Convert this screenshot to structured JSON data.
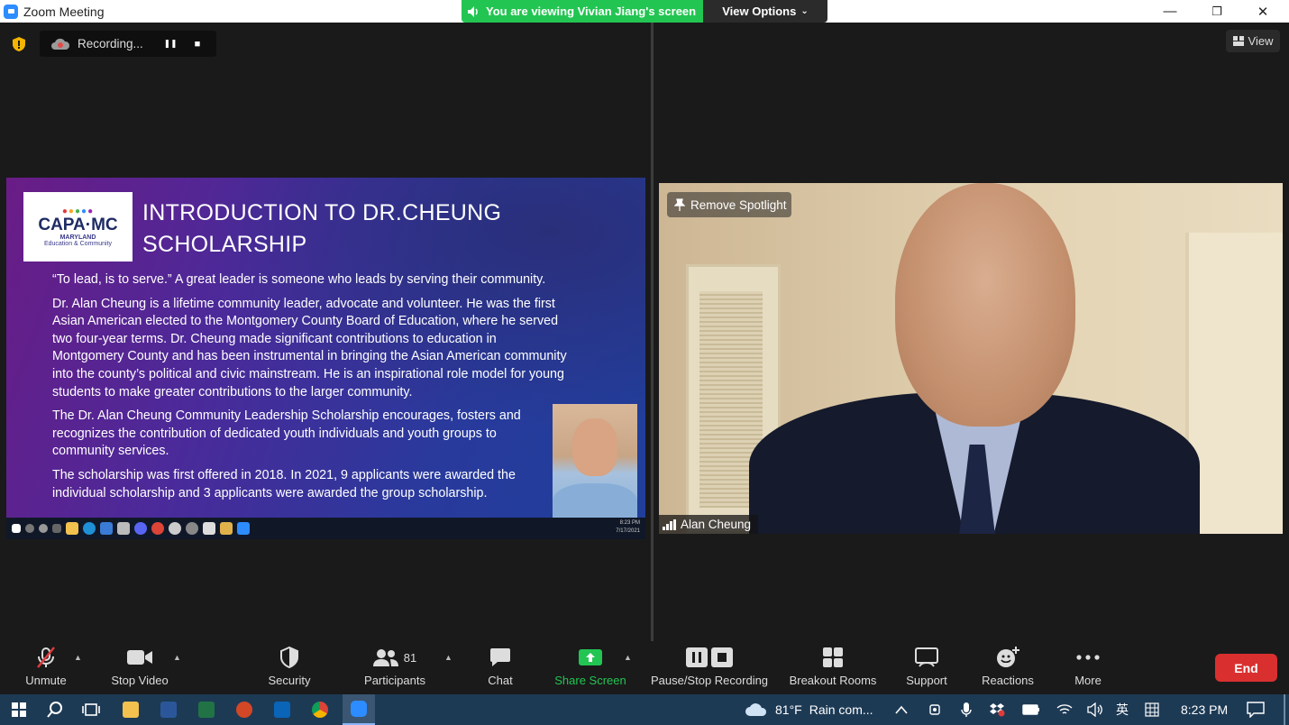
{
  "window": {
    "title": "Zoom Meeting",
    "minimize": "—",
    "restore": "❐",
    "close": "✕"
  },
  "share_banner": {
    "viewing": "You are viewing Vivian Jiang's screen",
    "view_options": "View Options"
  },
  "recording": {
    "label": "Recording...",
    "pause": "❚❚",
    "stop": "■"
  },
  "view_button": {
    "label": "View"
  },
  "slide": {
    "logo_name": "CAPA·MC",
    "logo_state": "MARYLAND",
    "logo_sub": "Education & Community",
    "title_line1": "INTRODUCTION TO DR.CHEUNG",
    "title_line2": "SCHOLARSHIP",
    "para1": "“To lead, is to serve.” A great leader is someone who leads by serving their community.",
    "para2": "Dr. Alan Cheung is a lifetime community leader, advocate and volunteer.  He was the first Asian American elected to the Montgomery County Board of Education, where he served two four-year terms. Dr. Cheung made significant contributions to education in Montgomery County and has been instrumental in bringing the Asian American community into the county’s political and civic mainstream. He is an inspirational role model for young students to make greater contributions to the larger community.",
    "para3": "The Dr. Alan Cheung Community Leadership Scholarship encourages, fosters and recognizes the contribution of dedicated youth individuals and youth groups to community services.",
    "para4": "The scholarship was first offered in 2018. In 2021, 9 applicants were awarded the individual scholarship and 3 applicants were awarded the group scholarship.",
    "clock_time": "8:23 PM",
    "clock_date": "7/17/2021"
  },
  "video": {
    "spotlight": "Remove Spotlight",
    "participant": "Alan Cheung"
  },
  "toolbar": {
    "unmute": "Unmute",
    "stop_video": "Stop Video",
    "security": "Security",
    "participants": "Participants",
    "participants_count": "81",
    "chat": "Chat",
    "share_screen": "Share Screen",
    "pause_stop_recording": "Pause/Stop Recording",
    "breakout_rooms": "Breakout Rooms",
    "support": "Support",
    "reactions": "Reactions",
    "more": "More",
    "end": "End"
  },
  "taskbar": {
    "weather_temp": "81°F",
    "weather_text": "Rain com...",
    "ime": "英",
    "time": "8:23 PM"
  },
  "colors": {
    "accent_green": "#23c552",
    "end_red": "#d9302f",
    "zoom_blue": "#2d8cff"
  }
}
